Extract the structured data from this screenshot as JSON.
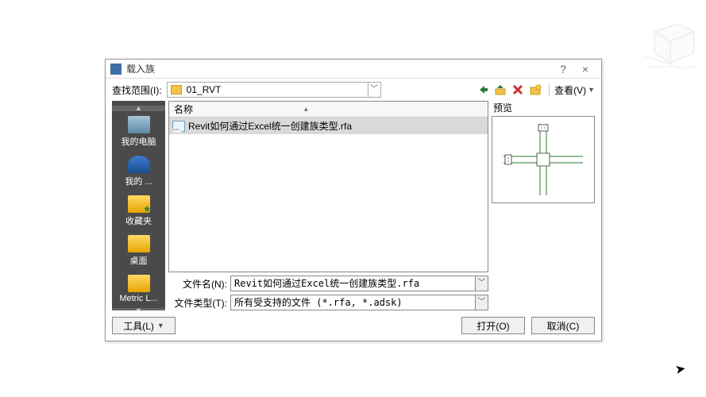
{
  "dialog": {
    "title": "载入族",
    "help_tooltip": "帮助",
    "close_tooltip": "关闭"
  },
  "toolbar": {
    "lookin_label": "查找范围(I):",
    "folder_name": "01_RVT",
    "back_tooltip": "后退",
    "up_tooltip": "上一级",
    "delete_tooltip": "删除",
    "newfolder_tooltip": "新建文件夹",
    "view_label": "查看(V)"
  },
  "places": [
    {
      "label": "我的电脑",
      "icon": "computer"
    },
    {
      "label": "我的 ...",
      "icon": "network"
    },
    {
      "label": "收藏夹",
      "icon": "fav"
    },
    {
      "label": "桌面",
      "icon": "folder"
    },
    {
      "label": "Metric L...",
      "icon": "folder"
    }
  ],
  "file_list": {
    "column_name": "名称",
    "rows": [
      {
        "name": "Revit如何通过Excel统一创建族类型.rfa",
        "selected": true
      }
    ]
  },
  "preview": {
    "label": "预览"
  },
  "inputs": {
    "filename_label": "文件名(N):",
    "filename_value": "Revit如何通过Excel统一创建族类型.rfa",
    "filetype_label": "文件类型(T):",
    "filetype_value": "所有受支持的文件 (*.rfa, *.adsk)"
  },
  "buttons": {
    "tools_label": "工具(L)",
    "open_label": "打开(O)",
    "cancel_label": "取消(C)"
  }
}
